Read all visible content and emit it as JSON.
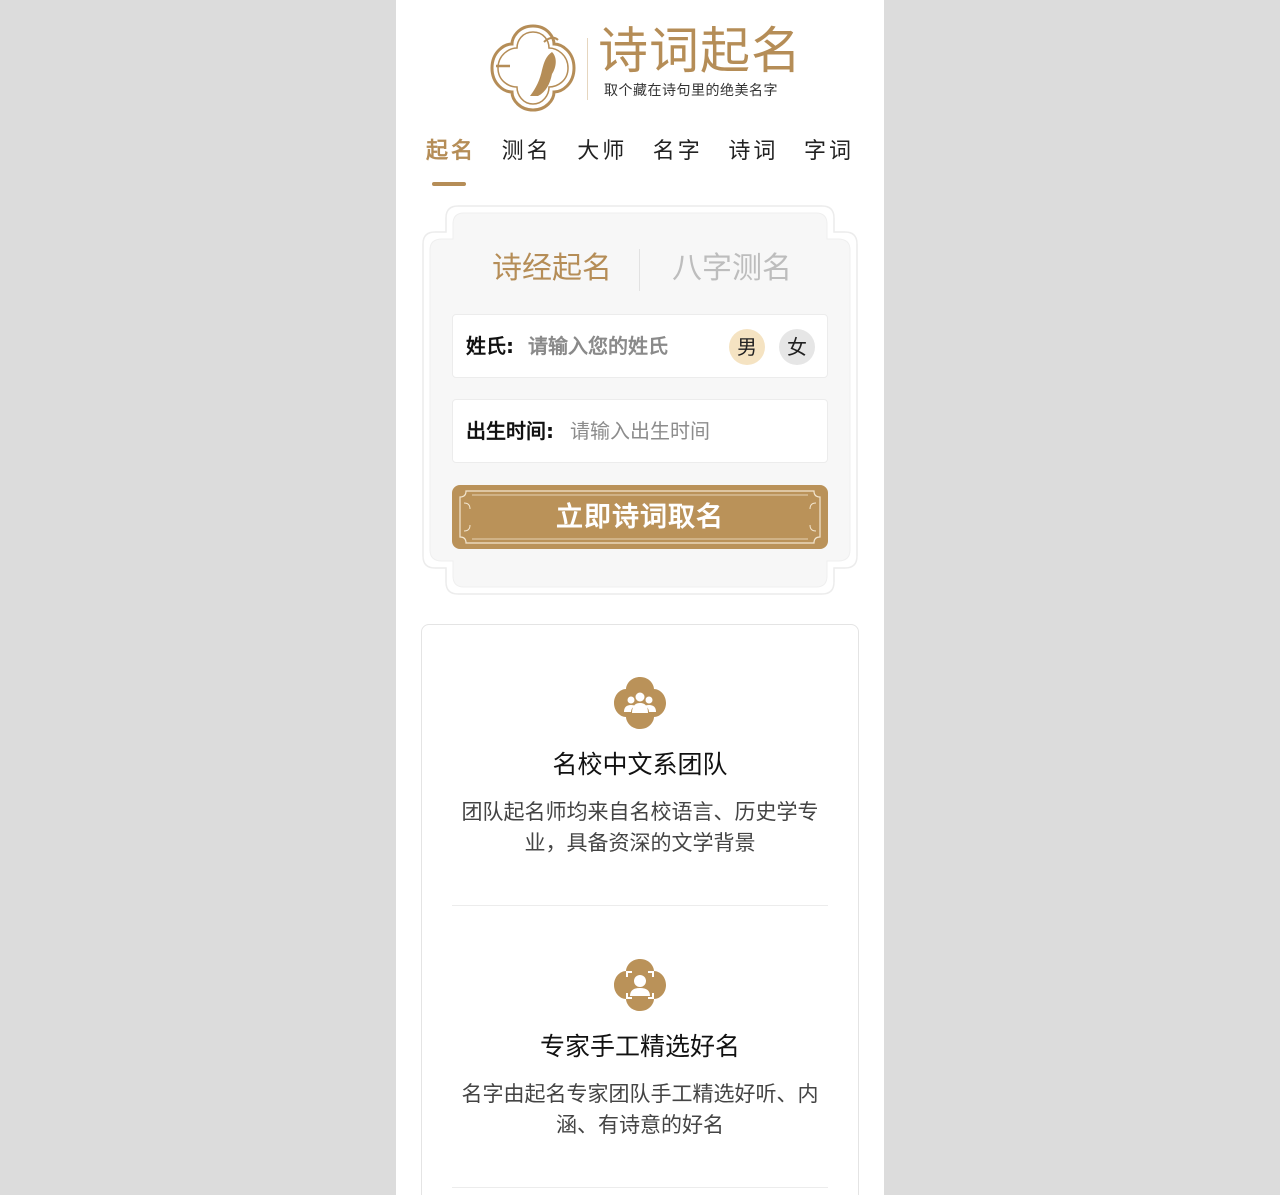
{
  "header": {
    "logo_mark_text": "诗词",
    "title": "诗词起名",
    "subtitle": "取个藏在诗句里的绝美名字"
  },
  "nav": {
    "items": [
      {
        "label": "起名",
        "active": true
      },
      {
        "label": "测名",
        "active": false
      },
      {
        "label": "大师",
        "active": false
      },
      {
        "label": "名字",
        "active": false
      },
      {
        "label": "诗词",
        "active": false
      },
      {
        "label": "字词",
        "active": false
      }
    ]
  },
  "form": {
    "tabs": [
      {
        "label": "诗经起名",
        "active": true
      },
      {
        "label": "八字测名",
        "active": false
      }
    ],
    "surname": {
      "label": "姓氏:",
      "placeholder": "请输入您的姓氏",
      "value": ""
    },
    "gender": {
      "male": "男",
      "female": "女",
      "selected": "男"
    },
    "birth": {
      "label": "出生时间:",
      "placeholder": "请输入出生时间",
      "value": ""
    },
    "submit_label": "立即诗词取名"
  },
  "features": [
    {
      "icon": "team-icon",
      "title": "名校中文系团队",
      "desc": "团队起名师均来自名校语言、历史学专业，具备资深的文学背景"
    },
    {
      "icon": "expert-icon",
      "title": "专家手工精选好名",
      "desc": "名字由起名专家团队手工精选好听、内涵、有诗意的好名"
    }
  ],
  "colors": {
    "accent": "#b58d57",
    "button": "#ba9259",
    "page_bg": "#dcdcdc",
    "male_bg": "#f5e3c2",
    "female_bg": "#e6e6e6"
  }
}
